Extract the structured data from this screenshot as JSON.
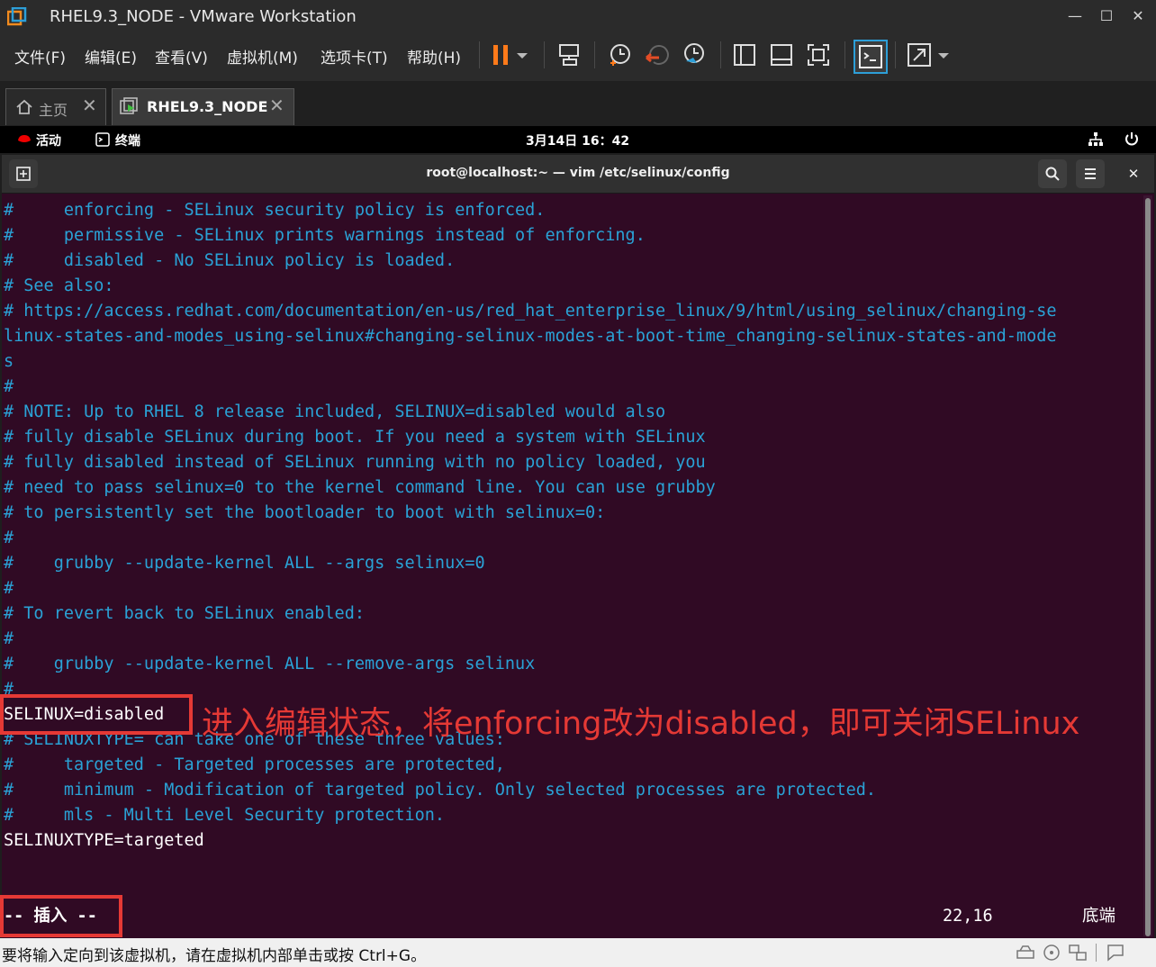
{
  "window": {
    "title": "RHEL9.3_NODE - VMware Workstation",
    "controls": [
      "—",
      "☐",
      "✕"
    ]
  },
  "menu": [
    "文件(F)",
    "编辑(E)",
    "查看(V)",
    "虚拟机(M)",
    "选项卡(T)",
    "帮助(H)"
  ],
  "toolbar_icons": [
    "pause-icon",
    "dropdown-icon",
    "send-keys-icon",
    "snapshot-icon",
    "revert-snapshot-icon",
    "snapshot-manager-icon",
    "library-icon",
    "thumbnail-icon",
    "fullscreen-icon",
    "console-icon",
    "stretch-icon"
  ],
  "tabs": [
    {
      "label": "主页",
      "icon": "home-icon",
      "active": false
    },
    {
      "label": "RHEL9.3_NODE",
      "icon": "vm-icon",
      "active": true
    }
  ],
  "gnome_topbar": {
    "activities": "活动",
    "app": "终端",
    "clock": "3月14日 16：42"
  },
  "terminal": {
    "title": "root@localhost:~ — vim /etc/selinux/config",
    "lines": [
      {
        "text": "#     enforcing - SELinux security policy is enforced.",
        "style": "comment"
      },
      {
        "text": "#     permissive - SELinux prints warnings instead of enforcing.",
        "style": "comment"
      },
      {
        "text": "#     disabled - No SELinux policy is loaded.",
        "style": "comment"
      },
      {
        "text": "# See also:",
        "style": "comment"
      },
      {
        "text": "# https://access.redhat.com/documentation/en-us/red_hat_enterprise_linux/9/html/using_selinux/changing-se",
        "style": "comment"
      },
      {
        "text": "linux-states-and-modes_using-selinux#changing-selinux-modes-at-boot-time_changing-selinux-states-and-mode",
        "style": "comment"
      },
      {
        "text": "s",
        "style": "comment"
      },
      {
        "text": "#",
        "style": "comment"
      },
      {
        "text": "# NOTE: Up to RHEL 8 release included, SELINUX=disabled would also",
        "style": "comment"
      },
      {
        "text": "# fully disable SELinux during boot. If you need a system with SELinux",
        "style": "comment"
      },
      {
        "text": "# fully disabled instead of SELinux running with no policy loaded, you",
        "style": "comment"
      },
      {
        "text": "# need to pass selinux=0 to the kernel command line. You can use grubby",
        "style": "comment"
      },
      {
        "text": "# to persistently set the bootloader to boot with selinux=0:",
        "style": "comment"
      },
      {
        "text": "#",
        "style": "comment"
      },
      {
        "text": "#    grubby --update-kernel ALL --args selinux=0",
        "style": "comment"
      },
      {
        "text": "#",
        "style": "comment"
      },
      {
        "text": "# To revert back to SELinux enabled:",
        "style": "comment"
      },
      {
        "text": "#",
        "style": "comment"
      },
      {
        "text": "#    grubby --update-kernel ALL --remove-args selinux",
        "style": "comment"
      },
      {
        "text": "#",
        "style": "comment"
      },
      {
        "text": "SELINUX=disabled",
        "style": "normal"
      },
      {
        "text": "# SELINUXTYPE= can take one of these three values:",
        "style": "comment"
      },
      {
        "text": "#     targeted - Targeted processes are protected,",
        "style": "comment"
      },
      {
        "text": "#     minimum - Modification of targeted policy. Only selected processes are protected.",
        "style": "comment"
      },
      {
        "text": "#     mls - Multi Level Security protection.",
        "style": "comment"
      },
      {
        "text": "SELINUXTYPE=targeted",
        "style": "normal"
      }
    ],
    "mode": "-- 插入 --",
    "position": "22,16",
    "scroll_pos": "底端"
  },
  "annotation": "进入编辑状态，将enforcing改为disabled，即可关闭SELinux",
  "statusbar": {
    "text": "要将输入定向到该虚拟机，请在虚拟机内部单击或按 Ctrl+G。"
  },
  "colors": {
    "terminal_bg": "#300a24",
    "comment": "#2aa2d6",
    "text": "#ffffff",
    "highlight": "#e53935",
    "pause_accent": "#ff7a1a"
  }
}
